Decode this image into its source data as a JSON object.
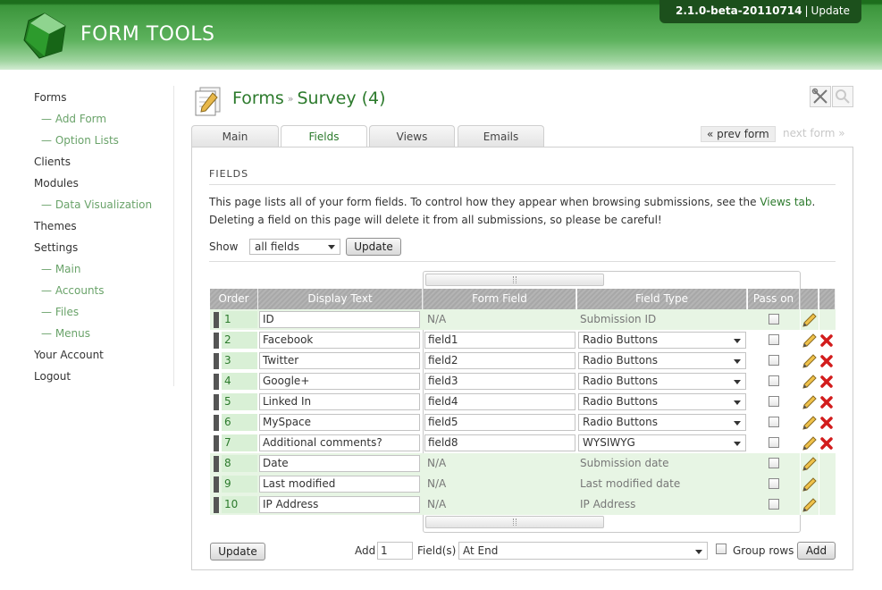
{
  "header": {
    "app_name": "FORM TOOLS",
    "version": "2.1.0-beta-20110714",
    "version_sep": "|",
    "update_link": "Update",
    "accent": "#3b953b"
  },
  "nav": {
    "items": [
      {
        "label": "Forms",
        "sub": false
      },
      {
        "label": "— Add Form",
        "sub": true
      },
      {
        "label": "— Option Lists",
        "sub": true
      },
      {
        "label": "Clients",
        "sub": false
      },
      {
        "label": "Modules",
        "sub": false
      },
      {
        "label": "— Data Visualization",
        "sub": true
      },
      {
        "label": "Themes",
        "sub": false
      },
      {
        "label": "Settings",
        "sub": false
      },
      {
        "label": "— Main",
        "sub": true
      },
      {
        "label": "— Accounts",
        "sub": true
      },
      {
        "label": "— Files",
        "sub": true
      },
      {
        "label": "— Menus",
        "sub": true
      },
      {
        "label": "Your Account",
        "sub": false
      },
      {
        "label": "Logout",
        "sub": false
      }
    ]
  },
  "title": {
    "section": "Forms",
    "arrow": "»",
    "form": "Survey (4)"
  },
  "tabs": [
    {
      "label": "Main",
      "active": false
    },
    {
      "label": "Fields",
      "active": true
    },
    {
      "label": "Views",
      "active": false
    },
    {
      "label": "Emails",
      "active": false
    }
  ],
  "pager": {
    "prev": "« prev form",
    "next": "next form »"
  },
  "fields_section": {
    "title": "FIELDS",
    "intro_before": "This page lists all of your form fields. To control how they appear when browsing submissions, see the ",
    "intro_link": "Views tab",
    "intro_after": ". Deleting a field on this page will delete it from all submissions, so please be careful!",
    "show_label": "Show",
    "show_value": "all fields",
    "update_label": "Update"
  },
  "table": {
    "headers": [
      "Order",
      "Display Text",
      "Form Field",
      "Field Type",
      "Pass on"
    ],
    "rows": [
      {
        "order": "1",
        "display": "ID",
        "field": "N/A",
        "type": "Submission ID",
        "system": true
      },
      {
        "order": "2",
        "display": "Facebook",
        "field": "field1",
        "type": "Radio Buttons",
        "system": false
      },
      {
        "order": "3",
        "display": "Twitter",
        "field": "field2",
        "type": "Radio Buttons",
        "system": false
      },
      {
        "order": "4",
        "display": "Google+",
        "field": "field3",
        "type": "Radio Buttons",
        "system": false
      },
      {
        "order": "5",
        "display": "Linked In",
        "field": "field4",
        "type": "Radio Buttons",
        "system": false
      },
      {
        "order": "6",
        "display": "MySpace",
        "field": "field5",
        "type": "Radio Buttons",
        "system": false
      },
      {
        "order": "7",
        "display": "Additional comments?",
        "field": "field8",
        "type": "WYSIWYG",
        "system": false
      },
      {
        "order": "8",
        "display": "Date",
        "field": "N/A",
        "type": "Submission date",
        "system": true
      },
      {
        "order": "9",
        "display": "Last modified",
        "field": "N/A",
        "type": "Last modified date",
        "system": true
      },
      {
        "order": "10",
        "display": "IP Address",
        "field": "N/A",
        "type": "IP Address",
        "system": true
      }
    ]
  },
  "footer": {
    "update_label": "Update",
    "add_label": "Add",
    "add_count": "1",
    "fields_label": "Field(s)",
    "position_value": "At End",
    "group_label": "Group rows",
    "add_button": "Add"
  }
}
